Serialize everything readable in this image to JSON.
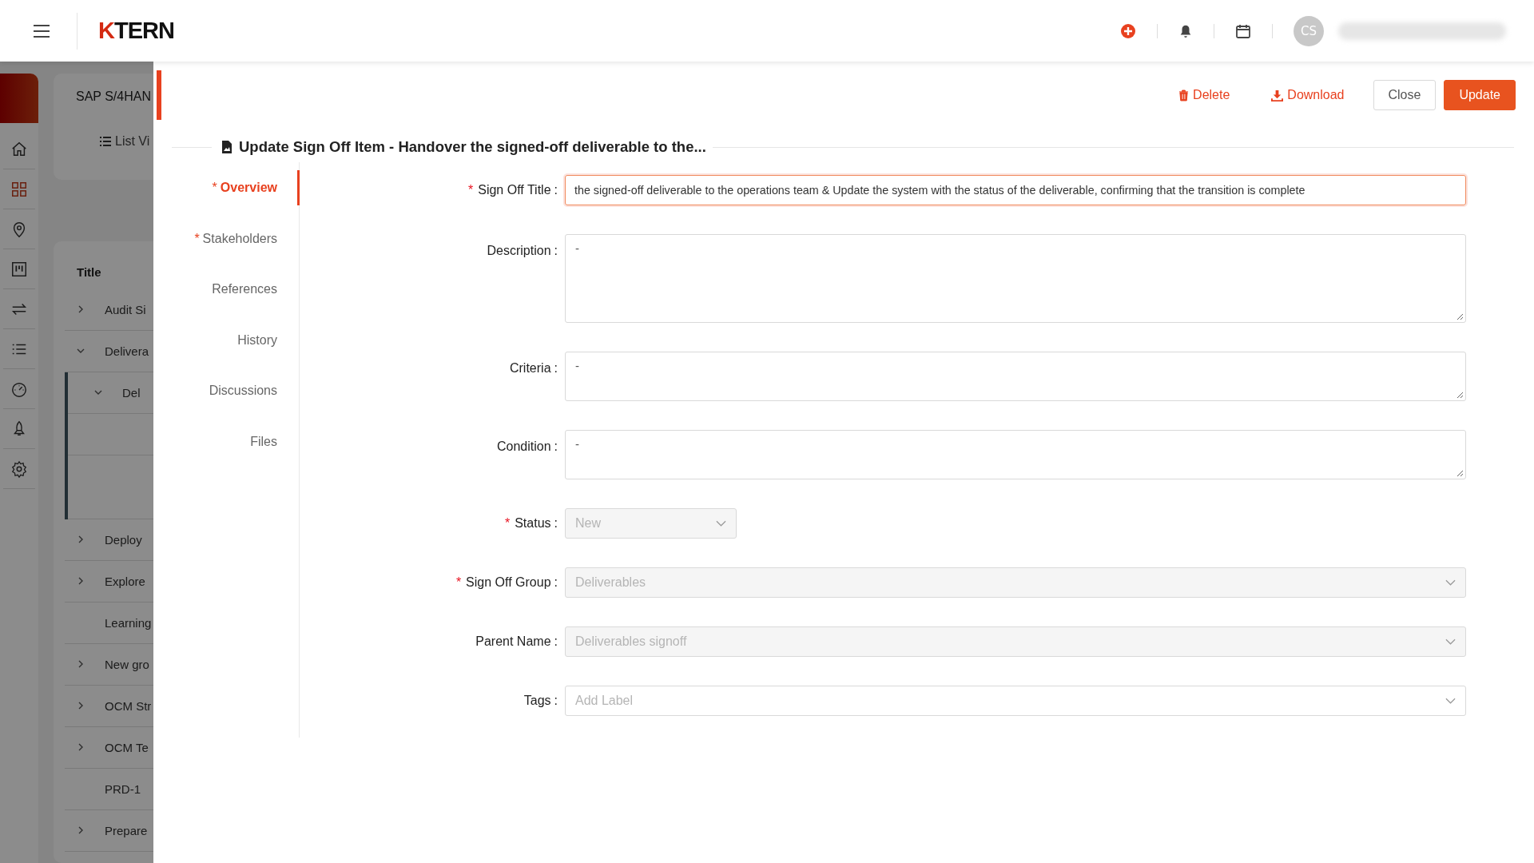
{
  "topbar": {
    "logo": {
      "mark": "K",
      "text": "TERN"
    },
    "avatar": "CS"
  },
  "sidebar": {
    "items": [
      {
        "kind": "home",
        "selected": false
      },
      {
        "kind": "grid",
        "selected": true
      },
      {
        "kind": "pin",
        "selected": false
      },
      {
        "kind": "board",
        "selected": false
      },
      {
        "kind": "swap",
        "selected": false
      },
      {
        "kind": "list",
        "selected": false
      },
      {
        "kind": "gauge",
        "selected": false
      },
      {
        "kind": "rocket",
        "selected": false
      },
      {
        "kind": "gear",
        "selected": false
      }
    ]
  },
  "project_card": {
    "title": "SAP S/4HAN",
    "view": "List Vi"
  },
  "tree": {
    "column": "Title",
    "rows": [
      {
        "label": "Audit Si",
        "expanded": false
      },
      {
        "label": "Delivera",
        "expanded": true,
        "children": [
          {
            "label": "Del",
            "expanded": true
          }
        ]
      },
      {
        "label": "Deploy",
        "expanded": false
      },
      {
        "label": "Explore",
        "expanded": false
      },
      {
        "label": "Learning"
      },
      {
        "label": "New gro",
        "expanded": false
      },
      {
        "label": "OCM Str",
        "expanded": false
      },
      {
        "label": "OCM Te",
        "expanded": false
      },
      {
        "label": "PRD-1"
      },
      {
        "label": "Prepare",
        "expanded": false
      }
    ]
  },
  "drawer": {
    "actions": [
      {
        "kind": "delete",
        "label": "Delete"
      },
      {
        "kind": "download",
        "label": "Download"
      },
      {
        "kind": "close",
        "label": "Close"
      },
      {
        "kind": "update",
        "label": "Update"
      }
    ],
    "title": "Update Sign Off Item - Handover the signed-off deliverable to the...",
    "tabs": [
      {
        "label": "Overview",
        "required_mark": "*",
        "selected": true
      },
      {
        "label": "Stakeholders",
        "required_mark": "*",
        "selected": false
      },
      {
        "label": "References",
        "selected": false
      },
      {
        "label": "History",
        "selected": false
      },
      {
        "label": "Discussions",
        "selected": false
      },
      {
        "label": "Files",
        "selected": false
      }
    ],
    "fields": [
      {
        "kind": "text",
        "label": "Sign Off Title",
        "required_mark": "*",
        "colon": ":",
        "focused": true,
        "value": "the signed-off deliverable to the operations team &  Update the system with the status of the deliverable, confirming that the transition is complete"
      },
      {
        "kind": "largetext",
        "label": "Description",
        "colon": ":",
        "value": "-"
      },
      {
        "kind": "textarea",
        "label": "Criteria",
        "colon": ":",
        "value": "-"
      },
      {
        "kind": "textarea",
        "label": "Condition",
        "colon": ":",
        "value": "-"
      },
      {
        "kind": "select",
        "label": "Status",
        "required_mark": "*",
        "colon": ":",
        "disabled": true,
        "narrow": true,
        "value": "New"
      },
      {
        "kind": "select",
        "label": "Sign Off Group",
        "required_mark": "*",
        "colon": ":",
        "disabled": true,
        "value": "Deliverables"
      },
      {
        "kind": "select",
        "label": "Parent Name",
        "colon": ":",
        "disabled": true,
        "value": "Deliverables signoff"
      },
      {
        "kind": "select",
        "label": "Tags",
        "colon": ":",
        "placeholder": "Add Label"
      }
    ]
  }
}
